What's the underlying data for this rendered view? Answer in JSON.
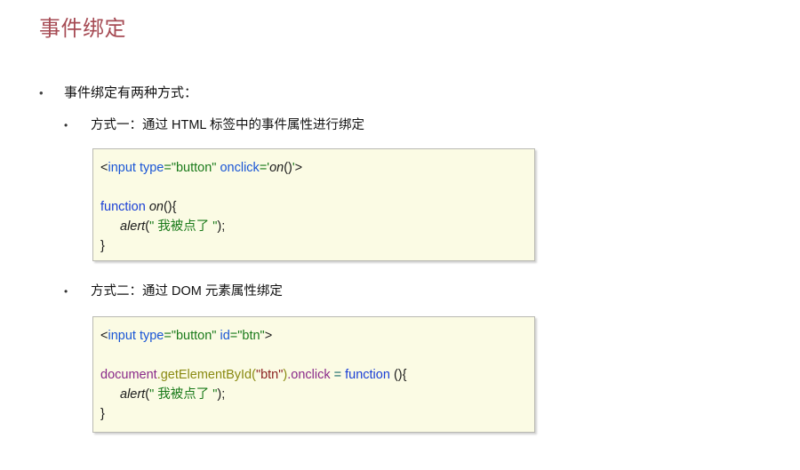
{
  "slide": {
    "title": "事件绑定",
    "theme": {
      "title_color": "#a64b54",
      "code_bg": "#fbfbe4",
      "code_border": "#b9b9b2",
      "text_color": "#111111"
    }
  },
  "bullets": {
    "level1_marker": "•",
    "level2_marker": "•",
    "intro": "事件绑定有两种方式：",
    "method_one": "方式一：通过 HTML 标签中的事件属性进行绑定",
    "method_two": "方式二：通过 DOM 元素属性绑定"
  },
  "code_one": {
    "line1": {
      "lt": "<",
      "tag": "input",
      "space1": " ",
      "attr1": "type",
      "eq1": "=",
      "val1": "\"button\"",
      "space2": " ",
      "attr2": "onclick",
      "eq2": "=",
      "quote_open": "'",
      "fn": "on",
      "parens": "()",
      "quote_close": "'",
      "gt": ">"
    },
    "line3": {
      "kw": "function",
      "space": " ",
      "fn": "on",
      "tail": "(){"
    },
    "line4": {
      "fn": "alert",
      "open": "(",
      "str": "\" 我被点了 \"",
      "close": ");"
    },
    "line5": {
      "brace": "}"
    }
  },
  "code_two": {
    "line1": {
      "lt": "<",
      "tag": "input",
      "space1": " ",
      "attr1": "type",
      "eq1": "=",
      "val1": "\"button\"",
      "space2": " ",
      "attr2": "id",
      "eq2": "=",
      "val2": "\"btn\"",
      "gt": ">"
    },
    "line3": {
      "obj": "document",
      "method": ".getElementById",
      "paren_open": "(",
      "str": "\"btn\"",
      "paren_close": ")",
      "prop": ".onclick",
      "op": " = ",
      "kw": "function",
      "tail": " (){"
    },
    "line4": {
      "fn": "alert",
      "open": "(",
      "str": "\" 我被点了 \"",
      "close": ");"
    },
    "line5": {
      "brace": "}"
    }
  }
}
